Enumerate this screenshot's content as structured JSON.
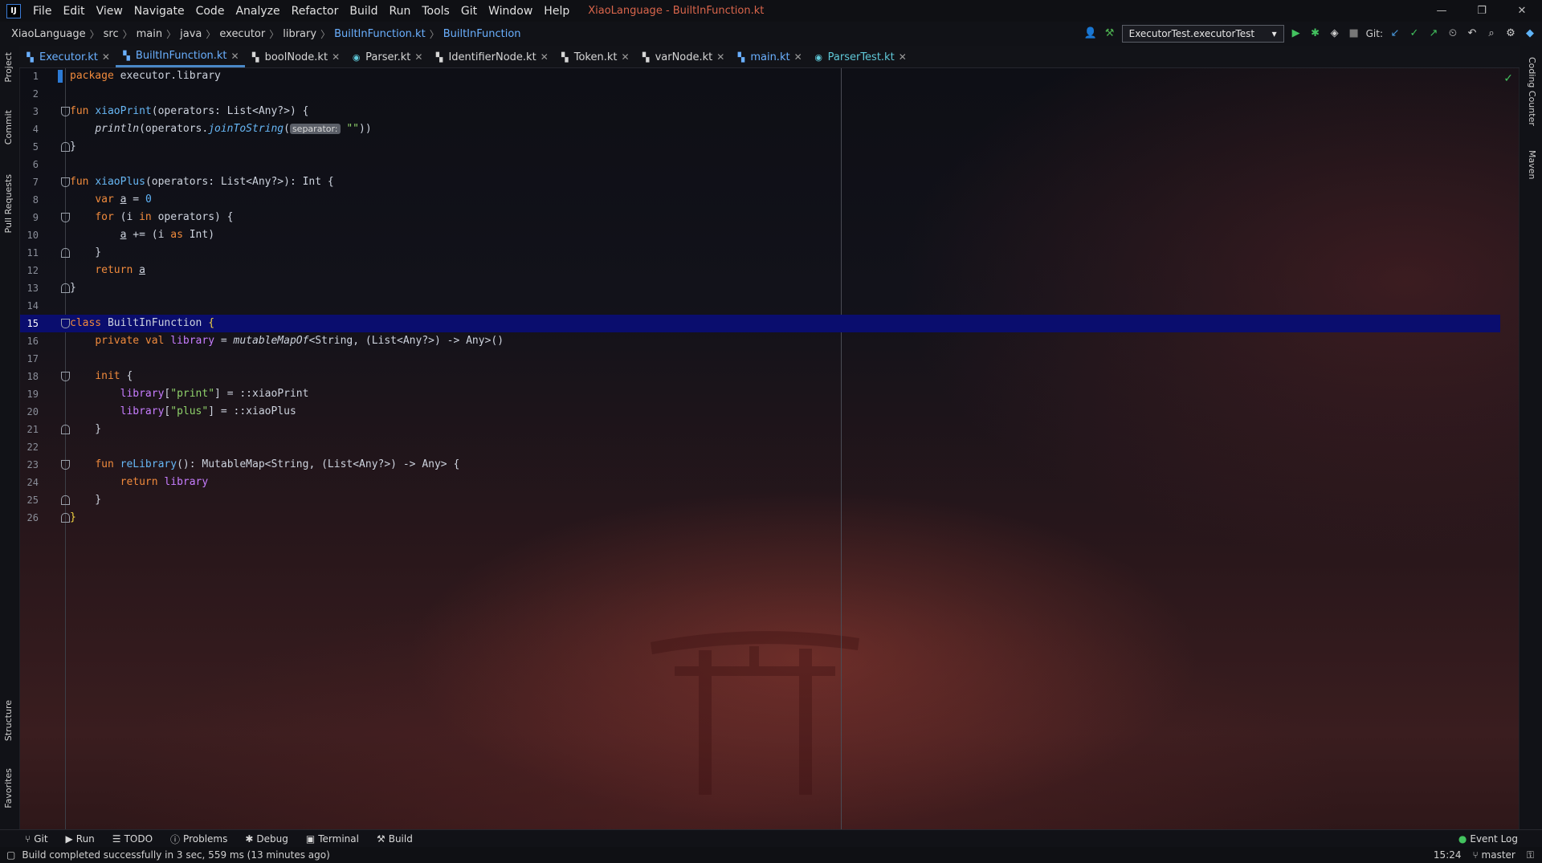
{
  "window": {
    "title": "XiaoLanguage - BuiltInFunction.kt",
    "menu": [
      "File",
      "Edit",
      "View",
      "Navigate",
      "Code",
      "Analyze",
      "Refactor",
      "Build",
      "Run",
      "Tools",
      "Git",
      "Window",
      "Help"
    ]
  },
  "breadcrumb": [
    "XiaoLanguage",
    "src",
    "main",
    "java",
    "executor",
    "library",
    "BuiltInFunction.kt",
    "BuiltInFunction"
  ],
  "run_config": "ExecutorTest.executorTest",
  "git_label": "Git:",
  "tabs": [
    {
      "label": "Executor.kt",
      "color": "blue"
    },
    {
      "label": "BuiltInFunction.kt",
      "color": "blue",
      "active": true
    },
    {
      "label": "boolNode.kt",
      "color": "normal"
    },
    {
      "label": "Parser.kt",
      "color": "normal"
    },
    {
      "label": "IdentifierNode.kt",
      "color": "normal"
    },
    {
      "label": "Token.kt",
      "color": "normal"
    },
    {
      "label": "varNode.kt",
      "color": "normal"
    },
    {
      "label": "main.kt",
      "color": "blue"
    },
    {
      "label": "ParserTest.kt",
      "color": "teal"
    }
  ],
  "left_tool_tabs": [
    "Project",
    "Commit",
    "Pull Requests",
    "Structure",
    "Favorites"
  ],
  "right_tool_tabs": [
    "Coding Counter",
    "Maven"
  ],
  "editor": {
    "line_numbers": [
      "1",
      "2",
      "3",
      "4",
      "5",
      "6",
      "7",
      "8",
      "9",
      "10",
      "11",
      "12",
      "13",
      "14",
      "15",
      "16",
      "17",
      "18",
      "19",
      "20",
      "21",
      "22",
      "23",
      "24",
      "25",
      "26"
    ],
    "current_line": "15",
    "hint_separator": "separator:"
  },
  "bottom_tools": [
    "Git",
    "Run",
    "TODO",
    "Problems",
    "Debug",
    "Terminal",
    "Build"
  ],
  "event_log": "Event Log",
  "status": {
    "message": "Build completed successfully in 3 sec, 559 ms (13 minutes ago)",
    "time": "15:24",
    "branch": "master"
  }
}
